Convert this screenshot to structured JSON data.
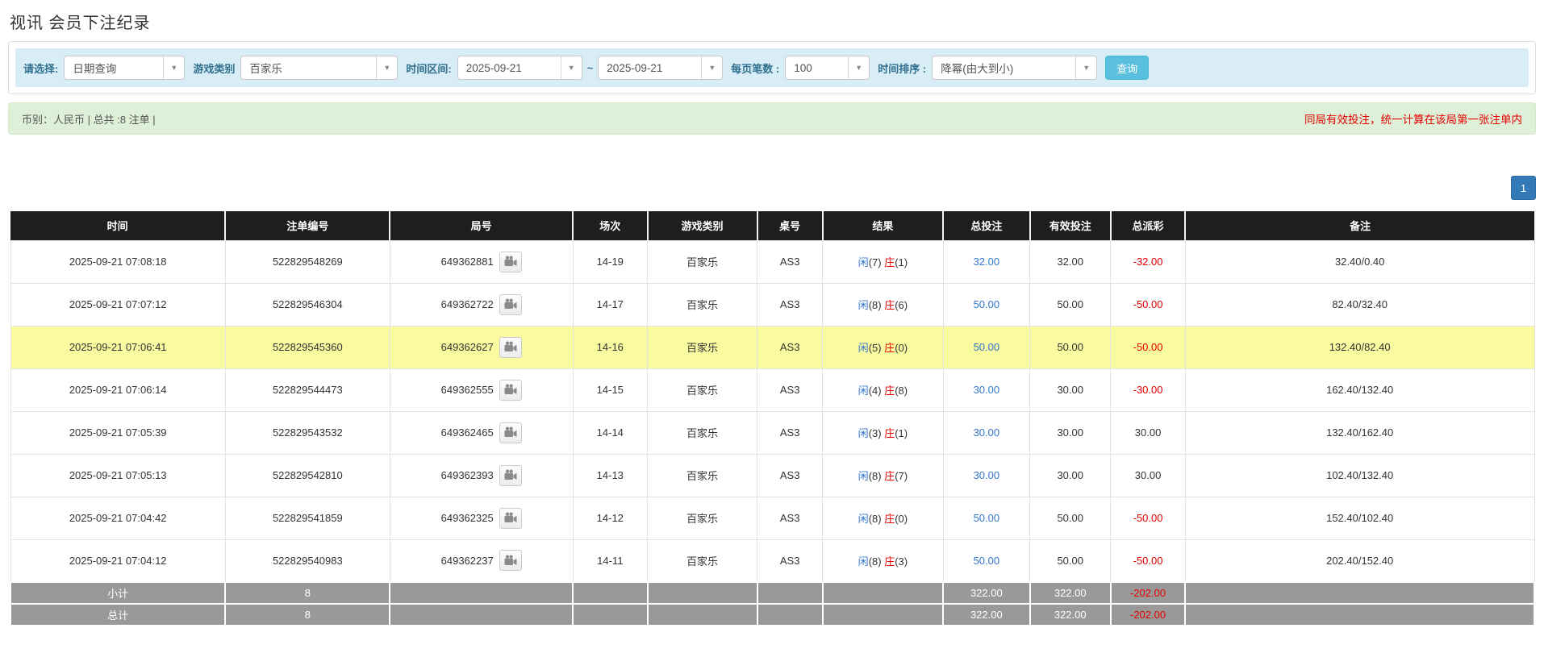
{
  "page": {
    "title": "视讯 会员下注纪录"
  },
  "colors": {
    "filter_bar_bg": "#d9edf7",
    "filter_label": "#31708f",
    "summary_bg": "#dff0d8",
    "notice_red": "#e60000",
    "header_bg": "#1e1e1e",
    "highlight_row": "#fafaa0",
    "summary_row_bg": "#999999",
    "link_blue": "#3377cc",
    "search_button_bg": "#5bc0de",
    "pagination_bg": "#337ab7"
  },
  "icons": {
    "dropdown_caret": "▼",
    "video": "video-camera-icon"
  },
  "filters": {
    "select_label": "请选择:",
    "select_value": "日期查询",
    "game_label": "游戏类别",
    "game_value": "百家乐",
    "range_label": "时间区间:",
    "date_from": "2025-09-21",
    "tilde": "~",
    "date_to": "2025-09-21",
    "page_size_label": "每页笔数 :",
    "page_size_value": "100",
    "sort_label": "时间排序 :",
    "sort_value": "降幂(由大到小)",
    "search_button": "查询"
  },
  "summary": {
    "left": "币别：人民币 | 总共 :8 注单 |",
    "notice": "同局有效投注，统一计算在该局第一张注单内"
  },
  "pagination": {
    "page": "1"
  },
  "table": {
    "headers": [
      "时间",
      "注单编号",
      "局号",
      "场次",
      "游戏类别",
      "桌号",
      "结果",
      "总投注",
      "有效投注",
      "总派彩",
      "备注"
    ],
    "rows": [
      {
        "time": "2025-09-21 07:08:18",
        "bet_no": "522829548269",
        "round_no": "649362881",
        "session": "14-19",
        "game": "百家乐",
        "table_no": "AS3",
        "result": {
          "player_label": "闲",
          "player_score": "(7)",
          "banker_label": "庄",
          "banker_score": "(1)"
        },
        "total_bet": "32.00",
        "valid_bet": "32.00",
        "payout": "-32.00",
        "remark": "32.40/0.40",
        "highlight": false
      },
      {
        "time": "2025-09-21 07:07:12",
        "bet_no": "522829546304",
        "round_no": "649362722",
        "session": "14-17",
        "game": "百家乐",
        "table_no": "AS3",
        "result": {
          "player_label": "闲",
          "player_score": "(8)",
          "banker_label": "庄",
          "banker_score": "(6)"
        },
        "total_bet": "50.00",
        "valid_bet": "50.00",
        "payout": "-50.00",
        "remark": "82.40/32.40",
        "highlight": false
      },
      {
        "time": "2025-09-21 07:06:41",
        "bet_no": "522829545360",
        "round_no": "649362627",
        "session": "14-16",
        "game": "百家乐",
        "table_no": "AS3",
        "result": {
          "player_label": "闲",
          "player_score": "(5)",
          "banker_label": "庄",
          "banker_score": "(0)"
        },
        "total_bet": "50.00",
        "valid_bet": "50.00",
        "payout": "-50.00",
        "remark": "132.40/82.40",
        "highlight": true
      },
      {
        "time": "2025-09-21 07:06:14",
        "bet_no": "522829544473",
        "round_no": "649362555",
        "session": "14-15",
        "game": "百家乐",
        "table_no": "AS3",
        "result": {
          "player_label": "闲",
          "player_score": "(4)",
          "banker_label": "庄",
          "banker_score": "(8)"
        },
        "total_bet": "30.00",
        "valid_bet": "30.00",
        "payout": "-30.00",
        "remark": "162.40/132.40",
        "highlight": false
      },
      {
        "time": "2025-09-21 07:05:39",
        "bet_no": "522829543532",
        "round_no": "649362465",
        "session": "14-14",
        "game": "百家乐",
        "table_no": "AS3",
        "result": {
          "player_label": "闲",
          "player_score": "(3)",
          "banker_label": "庄",
          "banker_score": "(1)"
        },
        "total_bet": "30.00",
        "valid_bet": "30.00",
        "payout": "30.00",
        "remark": "132.40/162.40",
        "highlight": false
      },
      {
        "time": "2025-09-21 07:05:13",
        "bet_no": "522829542810",
        "round_no": "649362393",
        "session": "14-13",
        "game": "百家乐",
        "table_no": "AS3",
        "result": {
          "player_label": "闲",
          "player_score": "(8)",
          "banker_label": "庄",
          "banker_score": "(7)"
        },
        "total_bet": "30.00",
        "valid_bet": "30.00",
        "payout": "30.00",
        "remark": "102.40/132.40",
        "highlight": false
      },
      {
        "time": "2025-09-21 07:04:42",
        "bet_no": "522829541859",
        "round_no": "649362325",
        "session": "14-12",
        "game": "百家乐",
        "table_no": "AS3",
        "result": {
          "player_label": "闲",
          "player_score": "(8)",
          "banker_label": "庄",
          "banker_score": "(0)"
        },
        "total_bet": "50.00",
        "valid_bet": "50.00",
        "payout": "-50.00",
        "remark": "152.40/102.40",
        "highlight": false
      },
      {
        "time": "2025-09-21 07:04:12",
        "bet_no": "522829540983",
        "round_no": "649362237",
        "session": "14-11",
        "game": "百家乐",
        "table_no": "AS3",
        "result": {
          "player_label": "闲",
          "player_score": "(8)",
          "banker_label": "庄",
          "banker_score": "(3)"
        },
        "total_bet": "50.00",
        "valid_bet": "50.00",
        "payout": "-50.00",
        "remark": "202.40/152.40",
        "highlight": false
      }
    ],
    "subtotal": {
      "label": "小计",
      "count": "8",
      "total_bet": "322.00",
      "valid_bet": "322.00",
      "payout": "-202.00"
    },
    "total": {
      "label": "总计",
      "count": "8",
      "total_bet": "322.00",
      "valid_bet": "322.00",
      "payout": "-202.00"
    }
  }
}
